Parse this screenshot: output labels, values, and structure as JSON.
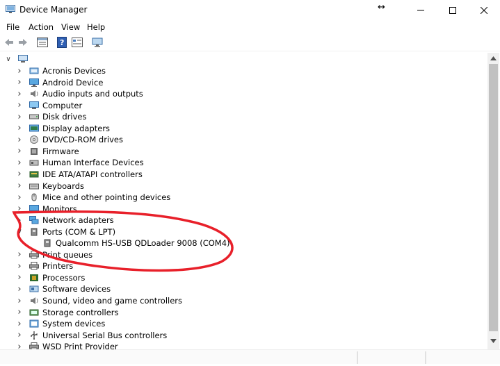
{
  "window": {
    "title": "Device Manager"
  },
  "menu": [
    "File",
    "Action",
    "View",
    "Help"
  ],
  "tree": {
    "root_label": "",
    "items": [
      {
        "label": "Acronis Devices",
        "icon": "device-icon",
        "expanded": false
      },
      {
        "label": "Android Device",
        "icon": "monitor-icon",
        "expanded": false
      },
      {
        "label": "Audio inputs and outputs",
        "icon": "speaker-icon",
        "expanded": false
      },
      {
        "label": "Computer",
        "icon": "computer-icon",
        "expanded": false
      },
      {
        "label": "Disk drives",
        "icon": "disk-icon",
        "expanded": false
      },
      {
        "label": "Display adapters",
        "icon": "display-adapter-icon",
        "expanded": false
      },
      {
        "label": "DVD/CD-ROM drives",
        "icon": "dvd-icon",
        "expanded": false
      },
      {
        "label": "Firmware",
        "icon": "firmware-icon",
        "expanded": false
      },
      {
        "label": "Human Interface Devices",
        "icon": "hid-icon",
        "expanded": false
      },
      {
        "label": "IDE ATA/ATAPI controllers",
        "icon": "ide-icon",
        "expanded": false
      },
      {
        "label": "Keyboards",
        "icon": "keyboard-icon",
        "expanded": false
      },
      {
        "label": "Mice and other pointing devices",
        "icon": "mouse-icon",
        "expanded": false
      },
      {
        "label": "Monitors",
        "icon": "monitor-icon",
        "expanded": false
      },
      {
        "label": "Network adapters",
        "icon": "network-icon",
        "expanded": false
      },
      {
        "label": "Ports (COM & LPT)",
        "icon": "port-icon",
        "expanded": true
      },
      {
        "label": "Qualcomm HS-USB QDLoader 9008 (COM4)",
        "icon": "port-icon",
        "child": true
      },
      {
        "label": "Print queues",
        "icon": "printer-icon",
        "expanded": false
      },
      {
        "label": "Printers",
        "icon": "printer-icon",
        "expanded": false
      },
      {
        "label": "Processors",
        "icon": "processor-icon",
        "expanded": false
      },
      {
        "label": "Software devices",
        "icon": "software-icon",
        "expanded": false
      },
      {
        "label": "Sound, video and game controllers",
        "icon": "speaker-icon",
        "expanded": false
      },
      {
        "label": "Storage controllers",
        "icon": "storage-icon",
        "expanded": false
      },
      {
        "label": "System devices",
        "icon": "system-icon",
        "expanded": false
      },
      {
        "label": "Universal Serial Bus controllers",
        "icon": "usb-icon",
        "expanded": false
      },
      {
        "label": "WSD Print Provider",
        "icon": "printer-icon",
        "expanded": false
      }
    ]
  },
  "colors": {
    "annotation": "#e8202a",
    "accent": "#1e90d6"
  }
}
